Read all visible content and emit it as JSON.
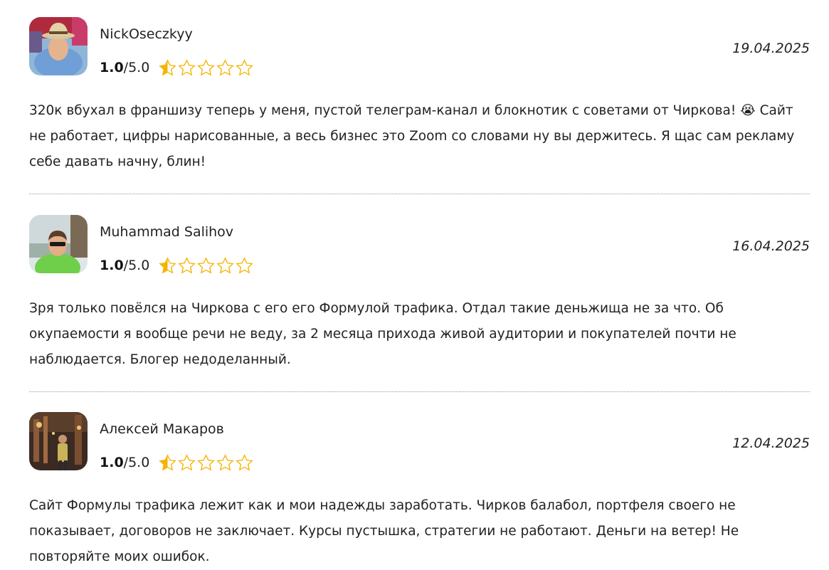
{
  "reviews": [
    {
      "author": "NickOseczkyy",
      "rating_value": "1.0",
      "rating_max": "/5.0",
      "rating": 1.0,
      "max_rating": 5,
      "date": "19.04.2025",
      "text": "320к вбухал в франшизу теперь у меня, пустой телеграм-канал и блокнотик с советами от Чиркова! 😭 Сайт не работает, цифры нарисованные, а весь бизнес это Zoom со словами ну вы держитесь. Я щас сам рекламу себе давать начну, блин!"
    },
    {
      "author": "Muhammad Salihov",
      "rating_value": "1.0",
      "rating_max": "/5.0",
      "rating": 1.0,
      "max_rating": 5,
      "date": "16.04.2025",
      "text": "Зря только повёлся на Чиркова с его его Формулой трафика. Отдал такие деньжища не за что. Об окупаемости я вообще речи не веду, за 2 месяца прихода живой аудитории и покупателей почти не наблюдается. Блогер недоделанный."
    },
    {
      "author": "Алексей Макаров",
      "rating_value": "1.0",
      "rating_max": "/5.0",
      "rating": 1.0,
      "max_rating": 5,
      "date": "12.04.2025",
      "text": "Сайт Формулы трафика лежит как и мои надежды заработать. Чирков балабол, портфеля своего не показывает, договоров не заключает. Курсы пустышка, стратегии не работают. Деньги на ветер! Не повторяйте моих ошибок."
    }
  ],
  "colors": {
    "star": "#f5b301",
    "text": "#222222",
    "divider": "#9a9a9a"
  },
  "icons": {
    "star_filled": "star-filled-icon",
    "star_partial": "star-partial-icon",
    "star_empty": "star-empty-icon"
  }
}
